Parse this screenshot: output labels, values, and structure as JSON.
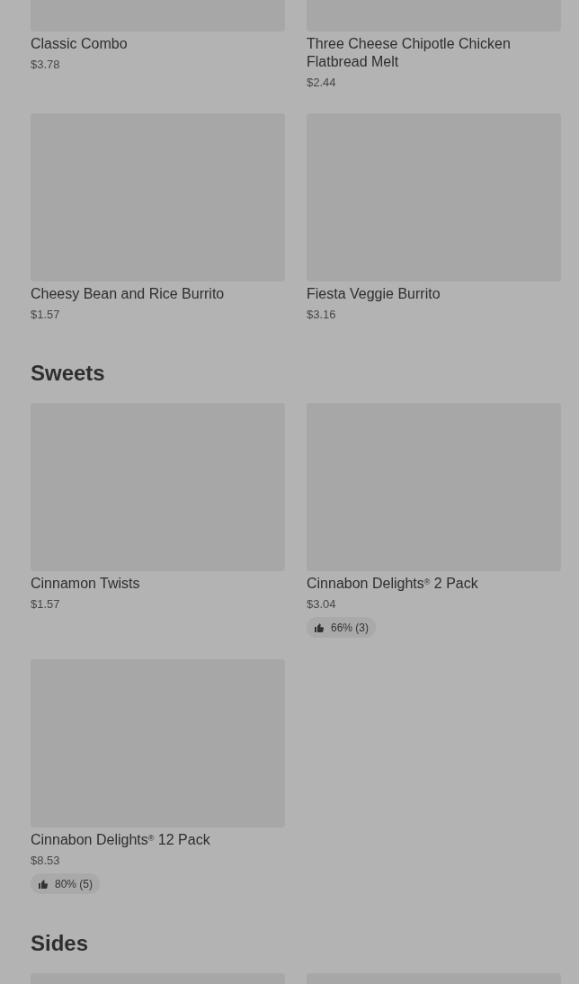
{
  "sections": [
    {
      "items": [
        {
          "kind": "product",
          "name": "Classic Combo",
          "price": "$3.78"
        },
        {
          "kind": "product",
          "name": "Three Cheese Chipotle Chicken Flatbread Melt",
          "price": "$2.44"
        },
        {
          "kind": "product",
          "name": "Cheesy Bean and Rice Burrito",
          "price": "$1.57"
        },
        {
          "kind": "product",
          "name": "Fiesta Veggie Burrito",
          "price": "$3.16"
        }
      ]
    },
    {
      "title": "Sweets",
      "items": [
        {
          "kind": "product",
          "name": "Cinnamon Twists",
          "price": "$1.57"
        },
        {
          "kind": "product",
          "name": "Cinnabon Delights$^{®}$ 2 Pack",
          "price": "$3.04",
          "rating": "66% (3)"
        },
        {
          "kind": "product",
          "name": "Cinnabon Delights$^{®}$ 12 Pack",
          "price": "$8.53",
          "rating": "80% (5)"
        }
      ]
    },
    {
      "title": "Sides"
    }
  ]
}
